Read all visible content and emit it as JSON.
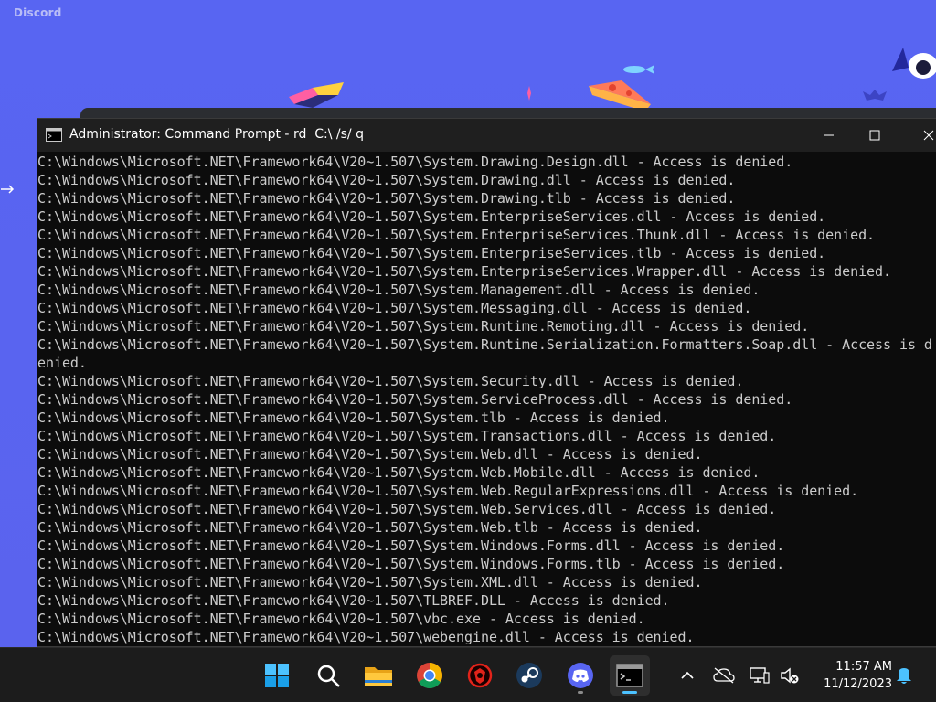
{
  "discord": {
    "app_name": "Discord"
  },
  "cmd": {
    "title": "Administrator: Command Prompt - rd  C:\\ /s/ q",
    "lines": [
      "C:\\Windows\\Microsoft.NET\\Framework64\\V20~1.507\\System.Drawing.Design.dll - Access is denied.",
      "C:\\Windows\\Microsoft.NET\\Framework64\\V20~1.507\\System.Drawing.dll - Access is denied.",
      "C:\\Windows\\Microsoft.NET\\Framework64\\V20~1.507\\System.Drawing.tlb - Access is denied.",
      "C:\\Windows\\Microsoft.NET\\Framework64\\V20~1.507\\System.EnterpriseServices.dll - Access is denied.",
      "C:\\Windows\\Microsoft.NET\\Framework64\\V20~1.507\\System.EnterpriseServices.Thunk.dll - Access is denied.",
      "C:\\Windows\\Microsoft.NET\\Framework64\\V20~1.507\\System.EnterpriseServices.tlb - Access is denied.",
      "C:\\Windows\\Microsoft.NET\\Framework64\\V20~1.507\\System.EnterpriseServices.Wrapper.dll - Access is denied.",
      "C:\\Windows\\Microsoft.NET\\Framework64\\V20~1.507\\System.Management.dll - Access is denied.",
      "C:\\Windows\\Microsoft.NET\\Framework64\\V20~1.507\\System.Messaging.dll - Access is denied.",
      "C:\\Windows\\Microsoft.NET\\Framework64\\V20~1.507\\System.Runtime.Remoting.dll - Access is denied.",
      "C:\\Windows\\Microsoft.NET\\Framework64\\V20~1.507\\System.Runtime.Serialization.Formatters.Soap.dll - Access is d",
      "enied.",
      "C:\\Windows\\Microsoft.NET\\Framework64\\V20~1.507\\System.Security.dll - Access is denied.",
      "C:\\Windows\\Microsoft.NET\\Framework64\\V20~1.507\\System.ServiceProcess.dll - Access is denied.",
      "C:\\Windows\\Microsoft.NET\\Framework64\\V20~1.507\\System.tlb - Access is denied.",
      "C:\\Windows\\Microsoft.NET\\Framework64\\V20~1.507\\System.Transactions.dll - Access is denied.",
      "C:\\Windows\\Microsoft.NET\\Framework64\\V20~1.507\\System.Web.dll - Access is denied.",
      "C:\\Windows\\Microsoft.NET\\Framework64\\V20~1.507\\System.Web.Mobile.dll - Access is denied.",
      "C:\\Windows\\Microsoft.NET\\Framework64\\V20~1.507\\System.Web.RegularExpressions.dll - Access is denied.",
      "C:\\Windows\\Microsoft.NET\\Framework64\\V20~1.507\\System.Web.Services.dll - Access is denied.",
      "C:\\Windows\\Microsoft.NET\\Framework64\\V20~1.507\\System.Web.tlb - Access is denied.",
      "C:\\Windows\\Microsoft.NET\\Framework64\\V20~1.507\\System.Windows.Forms.dll - Access is denied.",
      "C:\\Windows\\Microsoft.NET\\Framework64\\V20~1.507\\System.Windows.Forms.tlb - Access is denied.",
      "C:\\Windows\\Microsoft.NET\\Framework64\\V20~1.507\\System.XML.dll - Access is denied.",
      "C:\\Windows\\Microsoft.NET\\Framework64\\V20~1.507\\TLBREF.DLL - Access is denied.",
      "C:\\Windows\\Microsoft.NET\\Framework64\\V20~1.507\\vbc.exe - Access is denied.",
      "C:\\Windows\\Microsoft.NET\\Framework64\\V20~1.507\\webengine.dll - Access is denied."
    ],
    "icons": {
      "window": "cmd-window-icon",
      "minimize": "minimize-icon",
      "maximize": "maximize-icon",
      "close": "close-icon"
    }
  },
  "taskbar": {
    "apps": [
      {
        "name": "start-button",
        "icon": "windows-logo-icon",
        "running": false,
        "active": false
      },
      {
        "name": "search-button",
        "icon": "search-icon",
        "running": false,
        "active": false
      },
      {
        "name": "file-explorer-button",
        "icon": "folder-icon",
        "running": false,
        "active": false
      },
      {
        "name": "chrome-button",
        "icon": "chrome-icon",
        "running": false,
        "active": false
      },
      {
        "name": "red-app-button",
        "icon": "red-shield-icon",
        "running": false,
        "active": false
      },
      {
        "name": "steam-button",
        "icon": "steam-icon",
        "running": false,
        "active": false
      },
      {
        "name": "discord-button",
        "icon": "discord-icon",
        "running": true,
        "active": false
      },
      {
        "name": "terminal-button",
        "icon": "terminal-icon",
        "running": true,
        "active": true
      }
    ],
    "tray": {
      "icons": [
        "chevron-up-icon",
        "onedrive-offline-icon",
        "network-icon",
        "volume-muted-icon",
        "notification-bell-icon"
      ]
    },
    "clock": {
      "time": "11:57 AM",
      "date": "11/12/2023"
    }
  },
  "colors": {
    "discord_blurple": "#5865f2",
    "console_bg": "#0c0c0c",
    "console_text": "#cccccc",
    "titlebar_bg": "#1f1f1f",
    "taskbar_bg": "#1c1c1c",
    "active_indicator": "#4cc2ff"
  }
}
